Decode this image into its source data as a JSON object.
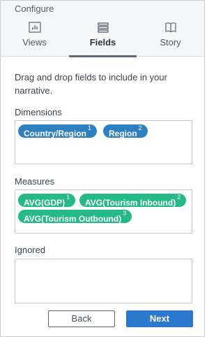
{
  "header": {
    "title": "Configure",
    "tabs": [
      {
        "label": "Views",
        "icon": "bar-chart-icon"
      },
      {
        "label": "Fields",
        "icon": "layers-icon",
        "active": true
      },
      {
        "label": "Story",
        "icon": "book-icon"
      }
    ]
  },
  "instruction": "Drag and drop fields to include in your narrative.",
  "dimensions": {
    "label": "Dimensions",
    "items": [
      {
        "name": "Country/Region",
        "badge": "1"
      },
      {
        "name": "Region",
        "badge": "2"
      }
    ]
  },
  "measures": {
    "label": "Measures",
    "items": [
      {
        "name": "AVG(GDP)",
        "badge": "1"
      },
      {
        "name": "AVG(Tourism Inbound)",
        "badge": "2"
      },
      {
        "name": "AVG(Tourism Outbound)",
        "badge": "3"
      }
    ]
  },
  "ignored": {
    "label": "Ignored",
    "items": []
  },
  "buttons": {
    "back": "Back",
    "next": "Next"
  },
  "colors": {
    "dimension_pill": "#2f80c0",
    "measure_pill": "#25b888",
    "primary_button": "#2b78cc"
  }
}
